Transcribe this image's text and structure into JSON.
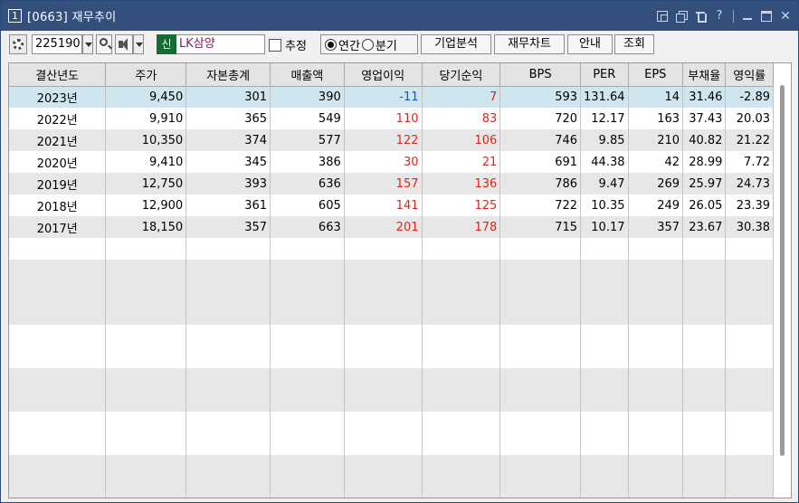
{
  "window": {
    "number": "1",
    "title": "[0663] 재무추이"
  },
  "toolbar": {
    "code": "225190",
    "badge": "신",
    "name": "LK삼양",
    "estimate_label": "추정",
    "radio_annual": "연간",
    "radio_quarter": "분기",
    "btn_company": "기업분석",
    "btn_chart": "재무차트",
    "btn_info": "안내",
    "btn_query": "조회"
  },
  "table": {
    "headers": [
      "결산년도",
      "주가",
      "자본총계",
      "매출액",
      "영업이익",
      "당기순익",
      "BPS",
      "PER",
      "EPS",
      "부채율",
      "영익률"
    ],
    "rows": [
      [
        "2023년",
        "9,450",
        "301",
        "390",
        "-11",
        "7",
        "593",
        "131.64",
        "14",
        "31.46",
        "-2.89"
      ],
      [
        "2022년",
        "9,910",
        "365",
        "549",
        "110",
        "83",
        "720",
        "12.17",
        "163",
        "37.43",
        "20.03"
      ],
      [
        "2021년",
        "10,350",
        "374",
        "577",
        "122",
        "106",
        "746",
        "9.85",
        "210",
        "40.82",
        "21.22"
      ],
      [
        "2020년",
        "9,410",
        "345",
        "386",
        "30",
        "21",
        "691",
        "44.38",
        "42",
        "28.99",
        "7.72"
      ],
      [
        "2019년",
        "12,750",
        "393",
        "636",
        "157",
        "136",
        "786",
        "9.47",
        "269",
        "25.97",
        "24.73"
      ],
      [
        "2018년",
        "12,900",
        "361",
        "605",
        "141",
        "125",
        "722",
        "10.35",
        "249",
        "26.05",
        "23.39"
      ],
      [
        "2017년",
        "18,150",
        "357",
        "663",
        "201",
        "178",
        "715",
        "10.17",
        "357",
        "23.67",
        "30.38"
      ]
    ]
  },
  "colors": {
    "titlebar": "#334f7c",
    "selected_row": "#cfe6ef",
    "negative": "#1d55c9",
    "positive": "#e0231c"
  }
}
